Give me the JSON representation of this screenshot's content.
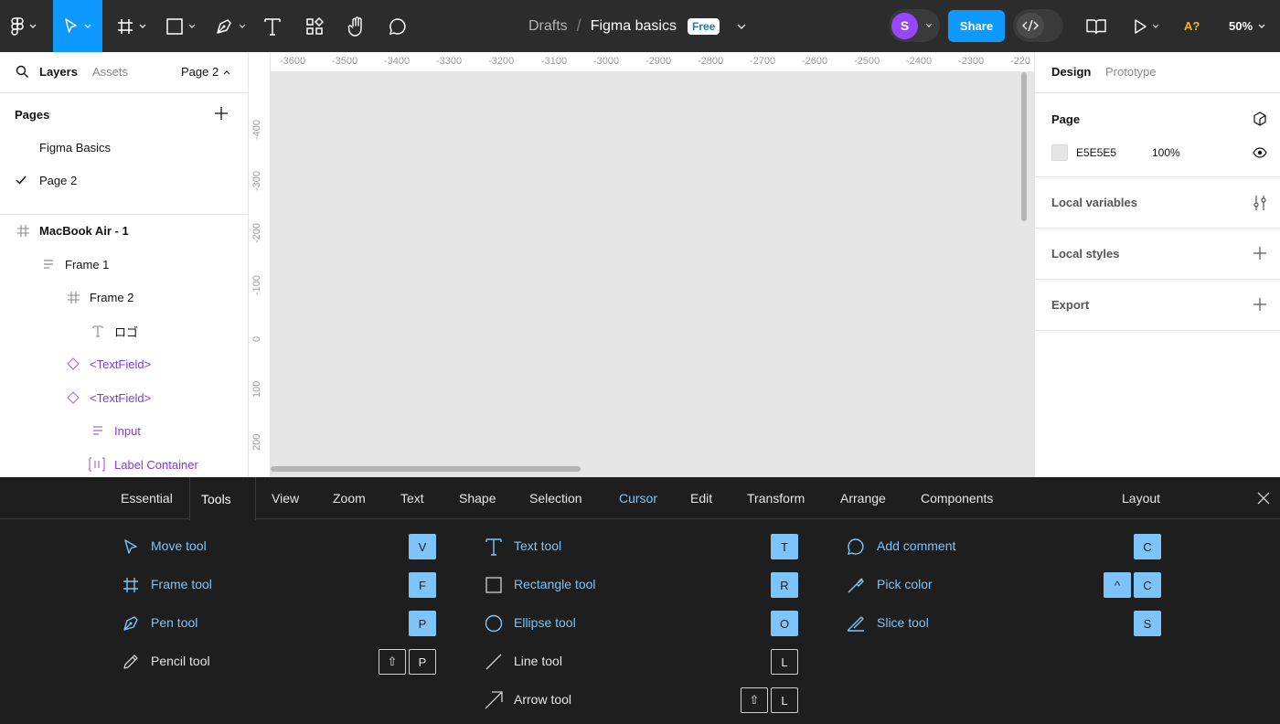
{
  "toolbar": {
    "breadcrumb_drafts": "Drafts",
    "breadcrumb_sep": "/",
    "file_name": "Figma basics",
    "plan_badge": "Free",
    "avatar_initial": "S",
    "share_label": "Share",
    "a11y_label": "A?",
    "zoom_label": "50%",
    "accent": "#0d99ff"
  },
  "left_panel": {
    "tab_layers": "Layers",
    "tab_assets": "Assets",
    "page_selector": "Page 2",
    "pages_title": "Pages",
    "pages": [
      {
        "name": "Figma Basics",
        "selected": false
      },
      {
        "name": "Page 2",
        "selected": true
      }
    ],
    "layers": [
      {
        "name": "MacBook Air - 1",
        "icon": "frame-icon"
      },
      {
        "name": "Frame 1",
        "icon": "autolayout-icon"
      },
      {
        "name": "Frame 2",
        "icon": "frame-icon"
      },
      {
        "name": "ロゴ",
        "icon": "text-icon"
      },
      {
        "name": "<TextField>",
        "icon": "component-instance-icon"
      },
      {
        "name": "<TextField>",
        "icon": "component-instance-icon"
      },
      {
        "name": "Input",
        "icon": "autolayout-icon"
      },
      {
        "name": "Label Container",
        "icon": "autolayout-columns-icon"
      }
    ]
  },
  "canvas": {
    "ruler_x": [
      "-3600",
      "-3500",
      "-3400",
      "-3300",
      "-3200",
      "-3100",
      "-3000",
      "-2900",
      "-2800",
      "-2700",
      "-2600",
      "-2500",
      "-2400",
      "-2300",
      "-220"
    ],
    "ruler_y": [
      "-400",
      "-300",
      "-200",
      "-100",
      "0",
      "100",
      "200"
    ],
    "background": "#e5e5e5"
  },
  "right_panel": {
    "tab_design": "Design",
    "tab_prototype": "Prototype",
    "page_title": "Page",
    "page_color_hex": "E5E5E5",
    "page_opacity": "100%",
    "local_variables": "Local variables",
    "local_styles": "Local styles",
    "export": "Export"
  },
  "shortcuts": {
    "tabs": [
      "Essential",
      "Tools",
      "View",
      "Zoom",
      "Text",
      "Shape",
      "Selection",
      "Cursor",
      "Edit",
      "Transform",
      "Arrange",
      "Components",
      "Layout"
    ],
    "active_tab": "Tools",
    "highlight_color": "#7cc4fa",
    "col1": [
      {
        "label": "Move tool",
        "icon": "move-tool-icon",
        "keys": [
          "V"
        ],
        "on": true
      },
      {
        "label": "Frame tool",
        "icon": "frame-tool-icon",
        "keys": [
          "F"
        ],
        "on": true
      },
      {
        "label": "Pen tool",
        "icon": "pen-tool-icon",
        "keys": [
          "P"
        ],
        "on": true
      },
      {
        "label": "Pencil tool",
        "icon": "pencil-tool-icon",
        "keys": [
          "⇧",
          "P"
        ],
        "on": false
      }
    ],
    "col2": [
      {
        "label": "Text tool",
        "icon": "text-tool-icon",
        "keys": [
          "T"
        ],
        "on": true
      },
      {
        "label": "Rectangle tool",
        "icon": "rectangle-tool-icon",
        "keys": [
          "R"
        ],
        "on": true
      },
      {
        "label": "Ellipse tool",
        "icon": "ellipse-tool-icon",
        "keys": [
          "O"
        ],
        "on": true
      },
      {
        "label": "Line tool",
        "icon": "line-tool-icon",
        "keys": [
          "L"
        ],
        "on": false
      },
      {
        "label": "Arrow tool",
        "icon": "arrow-tool-icon",
        "keys": [
          "⇧",
          "L"
        ],
        "on": false
      }
    ],
    "col3": [
      {
        "label": "Add comment",
        "icon": "comment-tool-icon",
        "keys": [
          "C"
        ],
        "on": true
      },
      {
        "label": "Pick color",
        "icon": "eyedropper-icon",
        "keys": [
          "^",
          "C"
        ],
        "on": true
      },
      {
        "label": "Slice tool",
        "icon": "slice-tool-icon",
        "keys": [
          "S"
        ],
        "on": true
      }
    ]
  }
}
